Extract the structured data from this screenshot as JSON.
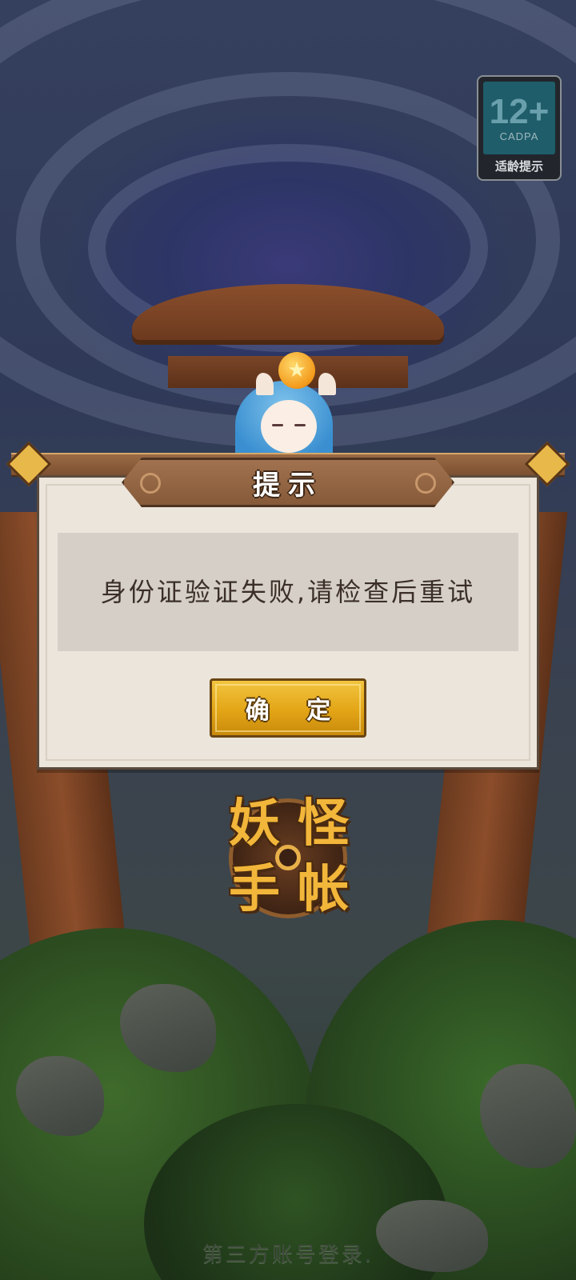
{
  "age_badge": {
    "rating": "12+",
    "org": "CADPA",
    "caption": "适龄提示"
  },
  "dialog": {
    "title": "提示",
    "message": "身份证验证失败,请检查后重试",
    "confirm_label": "确 定"
  },
  "logo": {
    "chars": [
      "妖",
      "怪",
      "手",
      "帐"
    ]
  },
  "footer": {
    "third_party_login": "第三方账号登录."
  },
  "colors": {
    "button_gold": "#e3a516",
    "dialog_bg": "#ebe5db",
    "title_plate": "#865a39",
    "badge_teal": "#1f5d6a"
  }
}
